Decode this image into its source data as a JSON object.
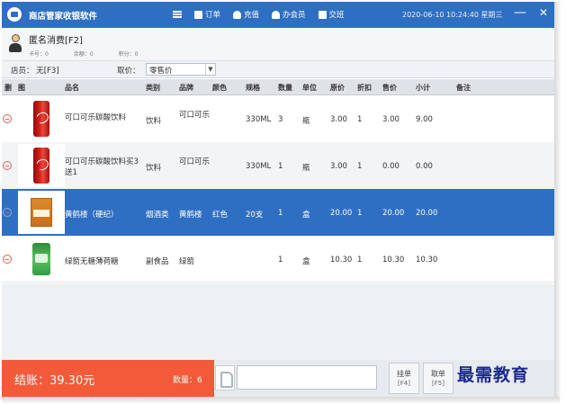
{
  "window": {
    "title": "商店管家收银软件",
    "menu": [
      {
        "icon": "menu-icon",
        "label": ""
      },
      {
        "icon": "order-icon",
        "label": "订单"
      },
      {
        "icon": "recharge-icon",
        "label": "充值"
      },
      {
        "icon": "member-icon",
        "label": "办会员"
      },
      {
        "icon": "handover-icon",
        "label": "交班"
      }
    ],
    "datetime": "2020-06-10 10:24:40 星期三",
    "minimize": "—",
    "close": "✕"
  },
  "member": {
    "name": "匿名消费[F2]",
    "stats": [
      "卡号：0",
      "余额：0",
      "积分：0"
    ]
  },
  "filter": {
    "staff": "店员：  无[F3]",
    "price_label": "取价：",
    "price_value": "零售价"
  },
  "table": {
    "columns": [
      "删",
      "图",
      "品名",
      "类别",
      "品牌",
      "颜色",
      "规格",
      "数量",
      "单位",
      "原价",
      "折扣",
      "售价",
      "小计",
      "备注"
    ],
    "rows": [
      {
        "name": "可口可乐碳酸饮料",
        "category": "饮料",
        "brand": "可口可乐",
        "color": "",
        "spec": "330ML",
        "qty": "3",
        "unit": "瓶",
        "orig_price": "3.00",
        "discount": "1",
        "price": "3.00",
        "subtotal": "9.00",
        "note": "",
        "image": "coca-cola-can"
      },
      {
        "name": "可口可乐碳酸饮料买3送1",
        "category": "饮料",
        "brand": "可口可乐",
        "color": "",
        "spec": "330ML",
        "qty": "1",
        "unit": "瓶",
        "orig_price": "3.00",
        "discount": "1",
        "price": "0.00",
        "subtotal": "0.00",
        "note": "",
        "image": "coca-cola-can"
      },
      {
        "name": "黄鹤楼（硬纪）",
        "category": "烟酒类",
        "brand": "黄鹤楼",
        "color": "红色",
        "spec": "20支",
        "qty": "1",
        "unit": "盒",
        "orig_price": "20.00",
        "discount": "1",
        "price": "20.00",
        "subtotal": "20.00",
        "note": "",
        "image": "cigarette-box"
      },
      {
        "name": "绿箭无糖薄荷糖",
        "category": "副食品",
        "brand": "绿箭",
        "color": "",
        "spec": "",
        "qty": "1",
        "unit": "盒",
        "orig_price": "10.30",
        "discount": "1",
        "price": "10.30",
        "subtotal": "10.30",
        "note": "",
        "image": "mint-pack"
      }
    ],
    "selected_row": 2
  },
  "footer": {
    "total_label": "结账：39.30元",
    "qty_label": "数量：6",
    "scan_placeholder": "",
    "buttons": [
      {
        "label": "挂单",
        "key": "[F4]"
      },
      {
        "label": "取单",
        "key": "[F5]"
      }
    ]
  },
  "watermark": "最需教育",
  "colors": {
    "titlebar": "#2f6fc3",
    "selected_row": "#2f6fc3",
    "checkout": "#f25a3a"
  }
}
